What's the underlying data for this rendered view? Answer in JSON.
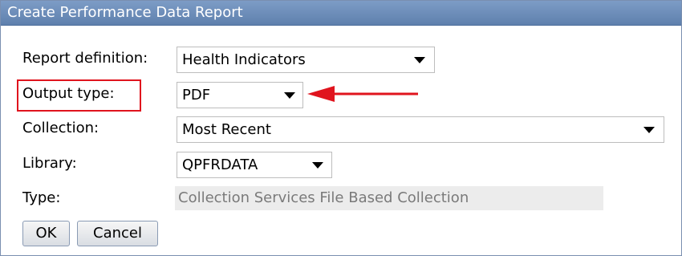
{
  "window": {
    "title": "Create Performance Data Report"
  },
  "form": {
    "report_definition": {
      "label": "Report definition:",
      "value": "Health Indicators"
    },
    "output_type": {
      "label": "Output type:",
      "value": "PDF"
    },
    "collection": {
      "label": "Collection:",
      "value": "Most Recent"
    },
    "library": {
      "label": "Library:",
      "value": "QPFRDATA"
    },
    "type": {
      "label": "Type:",
      "value": "Collection Services File Based Collection"
    }
  },
  "buttons": {
    "ok_label": "OK",
    "cancel_label": "Cancel"
  },
  "annotation": {
    "highlight_color": "#e0141e",
    "arrow_icon": "left-arrow-icon"
  },
  "colors": {
    "titlebar": "#6a8bb8",
    "readonly_bg": "#ececec",
    "readonly_text": "#7a7a7a"
  }
}
